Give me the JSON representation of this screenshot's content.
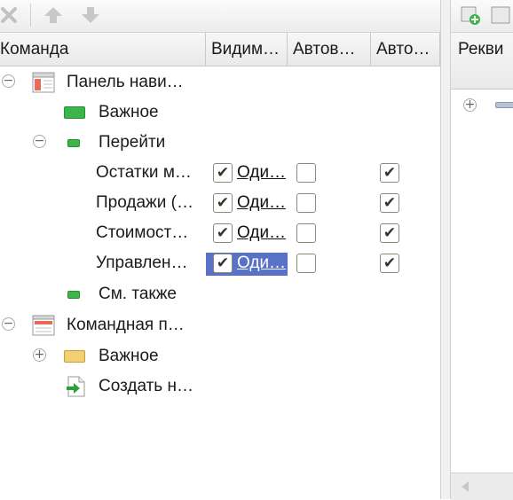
{
  "columns": {
    "command": "Команда",
    "visible": "Видим…",
    "auto1": "Автов…",
    "auto2": "Авто…"
  },
  "tree": {
    "nav_panel": "Панель нави…",
    "important": "Важное",
    "goto": "Перейти",
    "items": [
      {
        "label": "Остатки м…",
        "visible": true,
        "role_value": "Оди…",
        "auto1": false,
        "auto2": true
      },
      {
        "label": "Продажи (…",
        "visible": true,
        "role_value": "Оди…",
        "auto1": false,
        "auto2": true
      },
      {
        "label": "Стоимост…",
        "visible": true,
        "role_value": "Оди…",
        "auto1": false,
        "auto2": true
      },
      {
        "label": "Управлен…",
        "visible": true,
        "role_value": "Оди…",
        "auto1": false,
        "auto2": true,
        "selected": true
      }
    ],
    "see_also": "См. также",
    "command_panel": "Командная п…",
    "cp_important": "Важное",
    "create": "Создать н…"
  },
  "right_panel": {
    "header": "Рекви"
  },
  "colors": {
    "selection": "#5971c7",
    "green_group": "#3cb54a",
    "yellow_group": "#f3cf74"
  }
}
